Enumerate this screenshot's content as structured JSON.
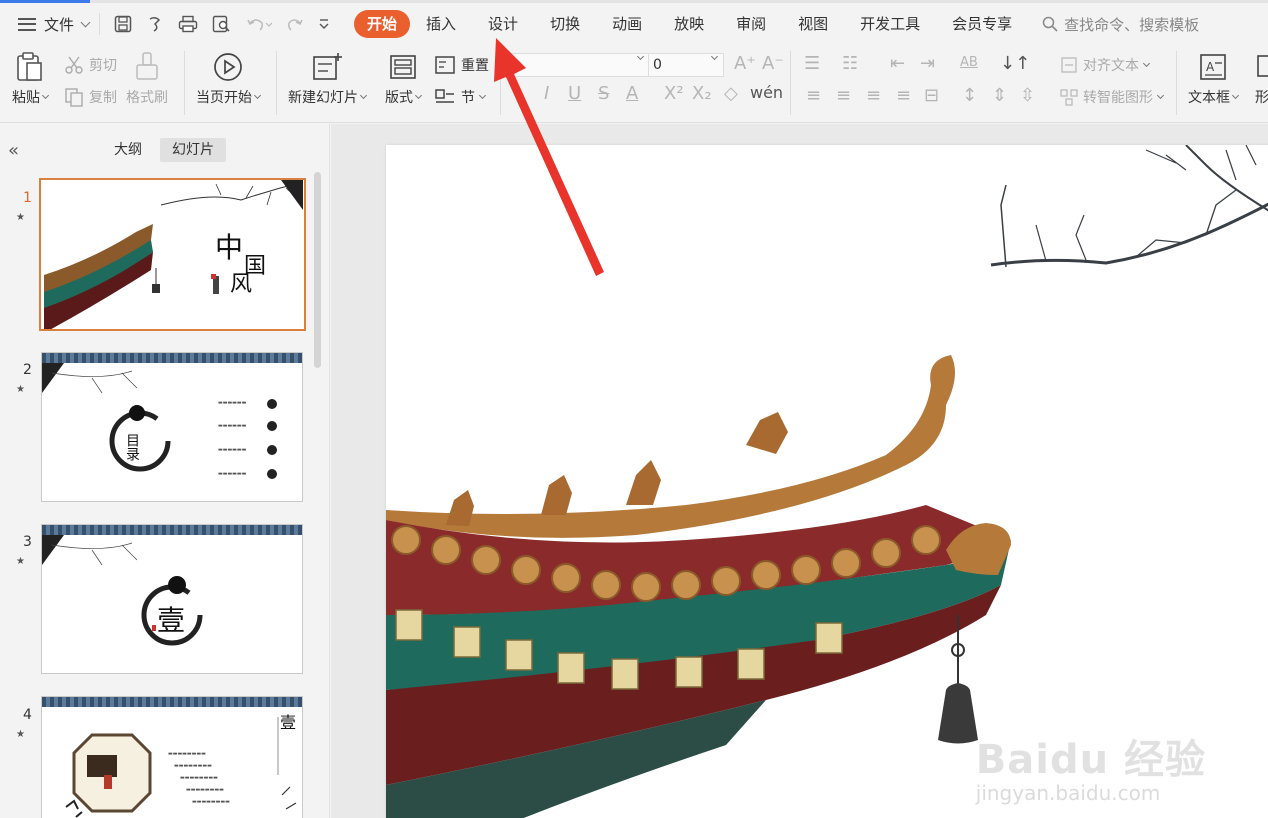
{
  "menubar": {
    "file_label": "文件",
    "tabs": [
      {
        "label": "开始",
        "active": true
      },
      {
        "label": "插入"
      },
      {
        "label": "设计"
      },
      {
        "label": "切换"
      },
      {
        "label": "动画"
      },
      {
        "label": "放映"
      },
      {
        "label": "审阅"
      },
      {
        "label": "视图"
      },
      {
        "label": "开发工具"
      },
      {
        "label": "会员专享"
      }
    ],
    "search_placeholder": "查找命令、搜索模板"
  },
  "ribbon": {
    "paste": "粘贴",
    "cut": "剪切",
    "copy": "复制",
    "format_painter": "格式刷",
    "from_current": "当页开始",
    "new_slide": "新建幻灯片",
    "layout": "版式",
    "reset": "重置",
    "section": "节",
    "font_size": "0",
    "align_text": "对齐文本",
    "smartart": "转智能图形",
    "textbox": "文本框",
    "shape_partial": "形"
  },
  "left_pane": {
    "tabs": [
      {
        "label": "大纲"
      },
      {
        "label": "幻灯片",
        "active": true
      }
    ],
    "slides": [
      {
        "number": "1",
        "title_a": "中",
        "title_b": "国",
        "title_c": "风"
      },
      {
        "number": "2",
        "toc_char": "目录"
      },
      {
        "number": "3",
        "big_char": "壹"
      },
      {
        "number": "4",
        "corner_char": "壹"
      }
    ]
  },
  "slide_preview": {
    "watermark_line1": "Baidu 经验",
    "watermark_line2": "jingyan.baidu.com"
  },
  "colors": {
    "accent": "#e95f2e",
    "arrow": "#e8342b",
    "active_thumb_border": "#d9803f"
  }
}
